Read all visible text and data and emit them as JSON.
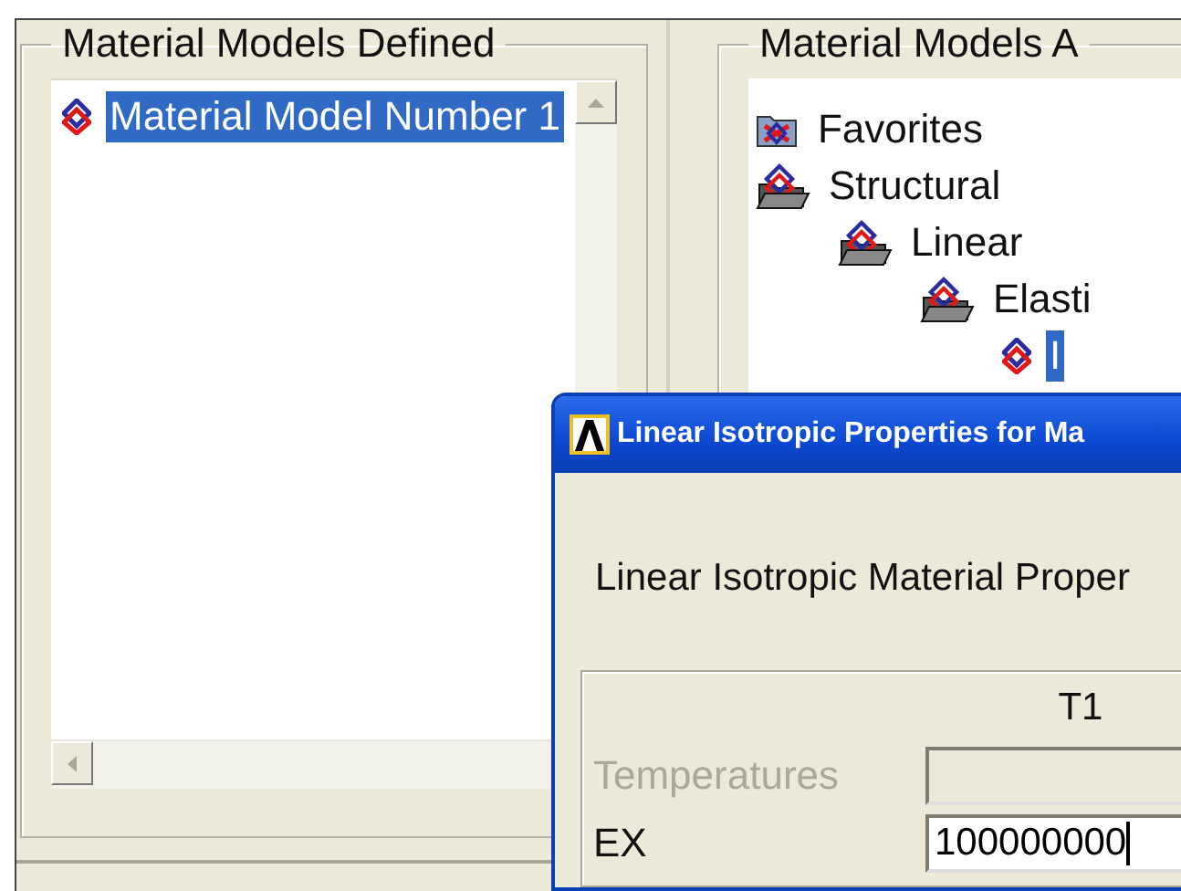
{
  "left_panel": {
    "title": "Material Models Defined",
    "items": [
      {
        "label": "Material Model Number 1",
        "selected": true
      }
    ]
  },
  "right_panel": {
    "title": "Material Models A",
    "tree": [
      {
        "label": "Favorites",
        "kind": "favorites",
        "selected": false
      },
      {
        "label": "Structural",
        "kind": "folder",
        "selected": false,
        "children": [
          {
            "label": "Linear",
            "kind": "folder",
            "selected": false,
            "children": [
              {
                "label": "Elasti",
                "kind": "folder",
                "selected": false,
                "children": [
                  {
                    "label": "I",
                    "kind": "model",
                    "selected": true
                  }
                ]
              }
            ]
          }
        ]
      }
    ]
  },
  "dialog": {
    "title": "Linear Isotropic Properties for Ma",
    "heading": "Linear Isotropic Material Proper",
    "columns": [
      "T1"
    ],
    "rows": [
      {
        "label": "Temperatures",
        "disabled": true,
        "focused": false
      },
      {
        "label": "EX",
        "value": "100000000",
        "disabled": false,
        "focused": true
      }
    ]
  }
}
